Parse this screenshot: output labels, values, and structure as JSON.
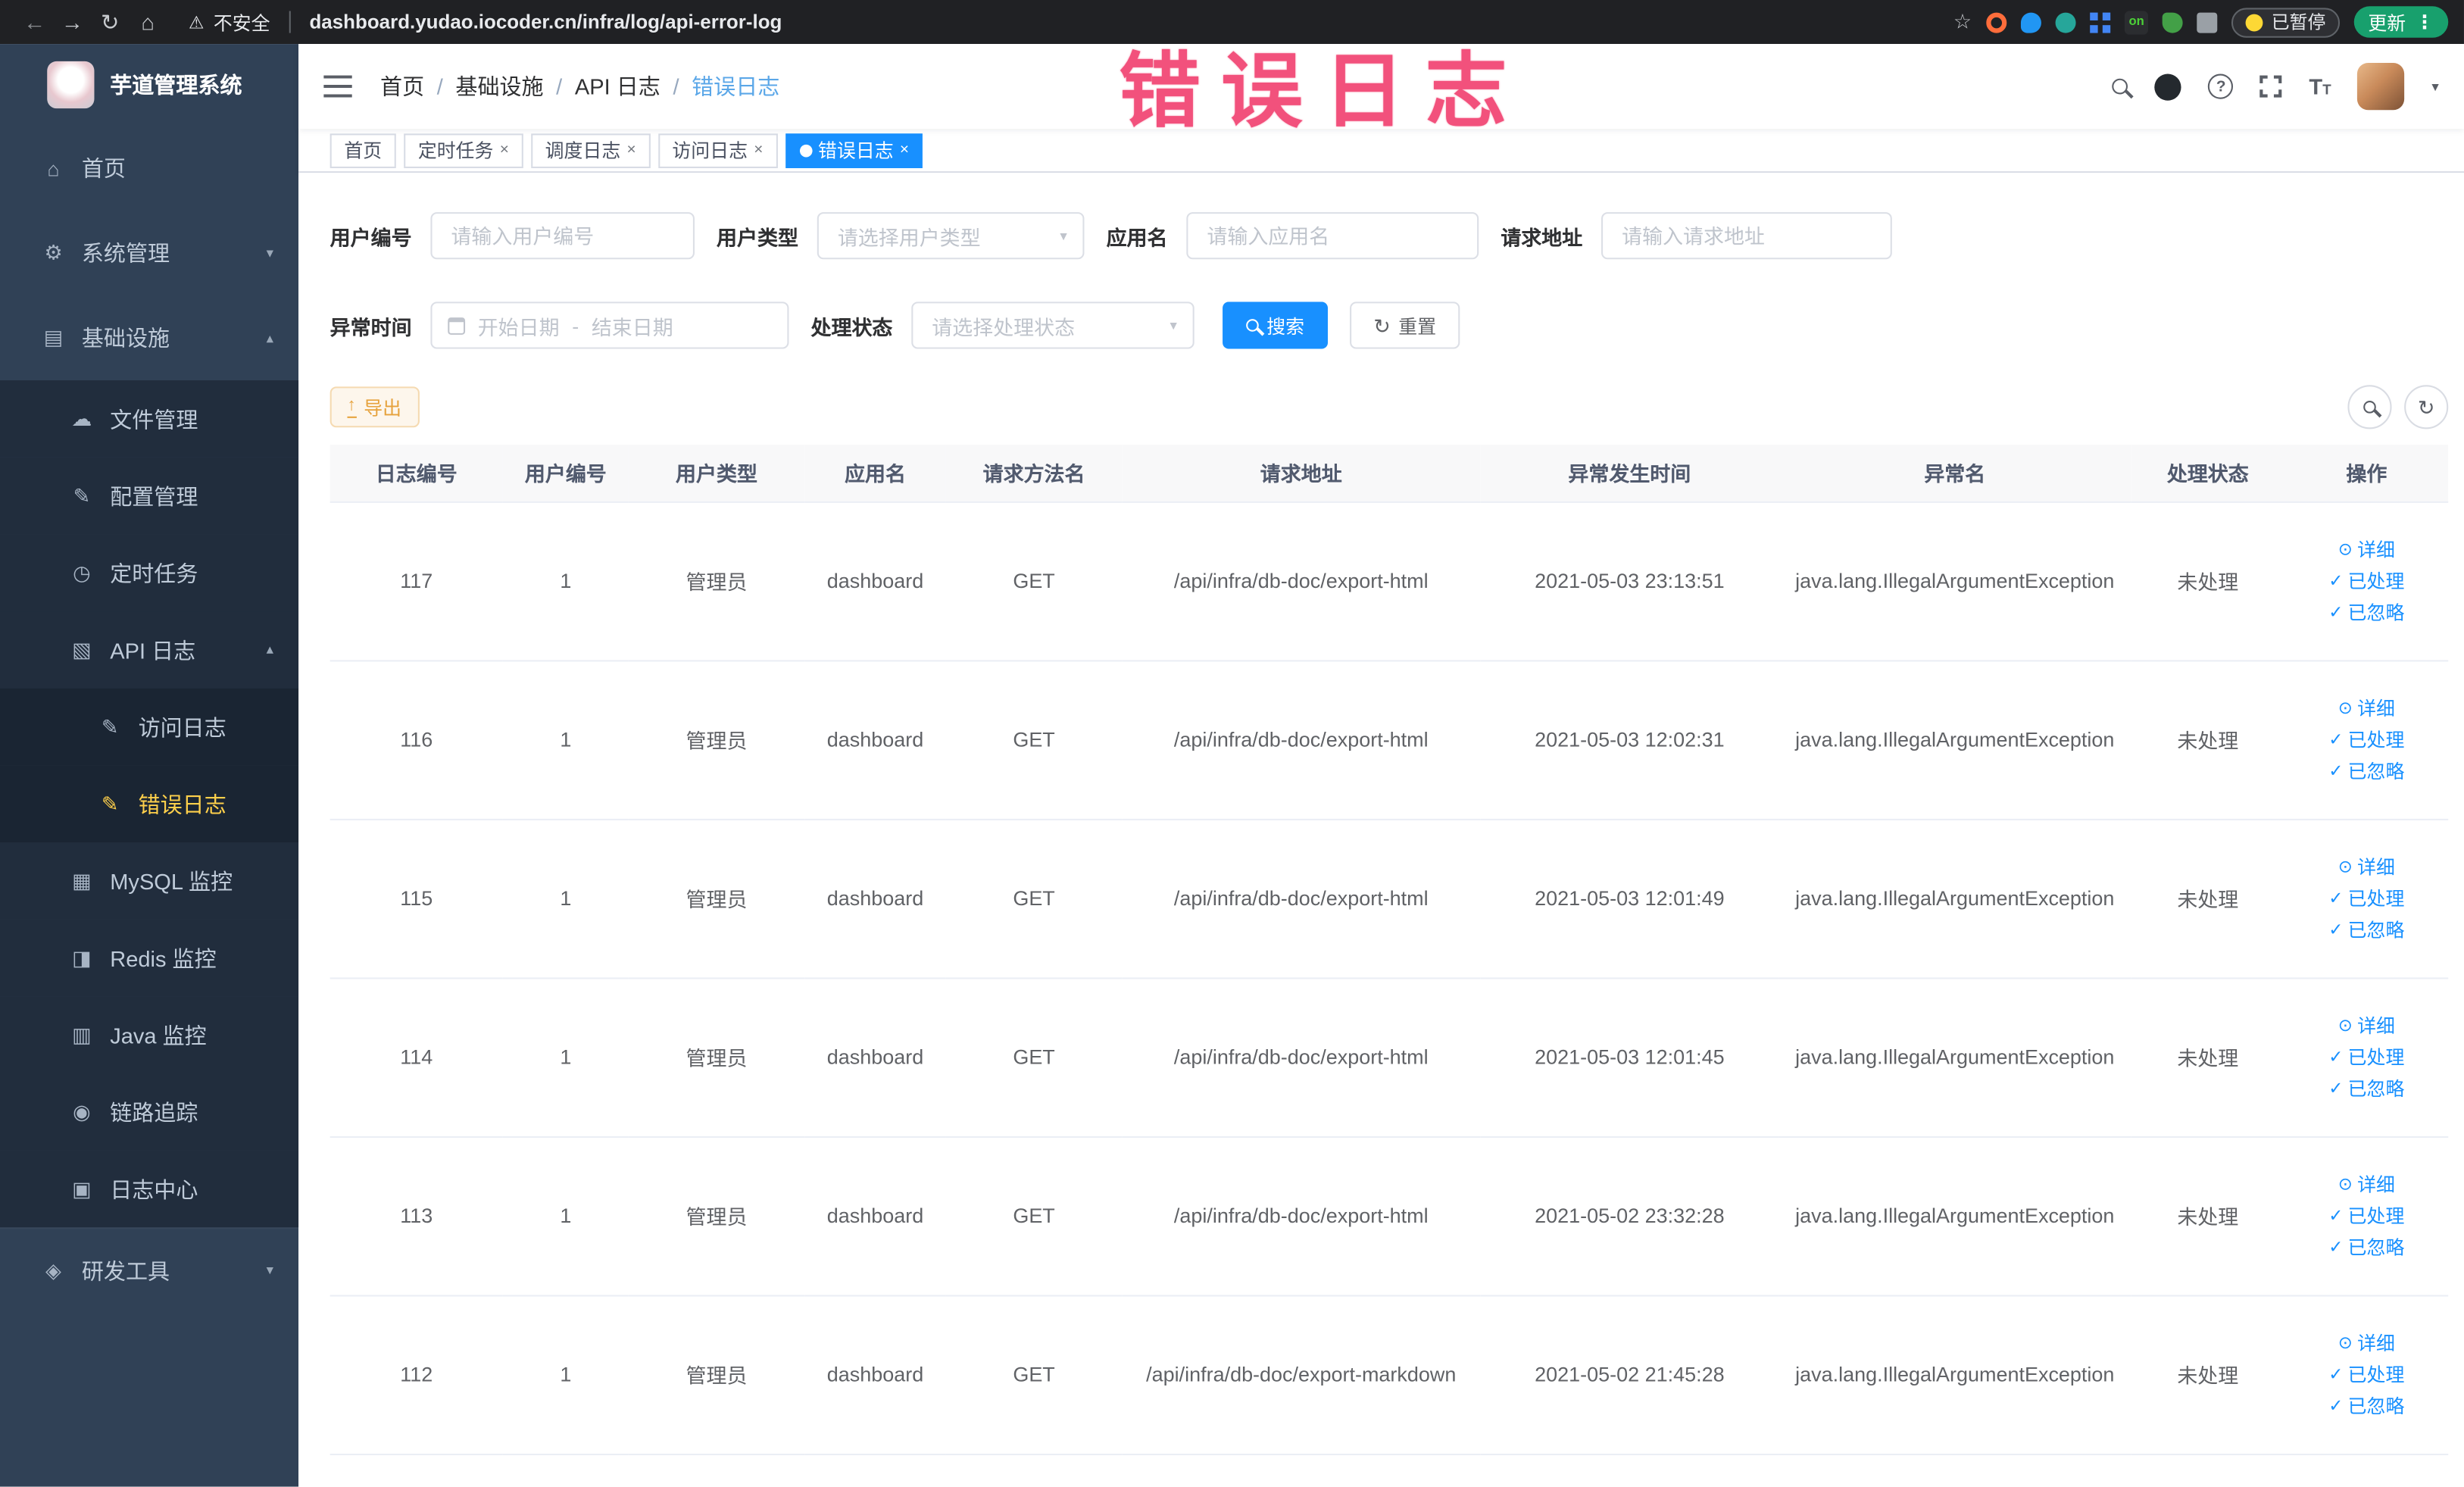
{
  "browser": {
    "security_label": "不安全",
    "url": "dashboard.yudao.iocoder.cn/infra/log/api-error-log",
    "ext_on_label": "on",
    "paused_badge": "已暂停",
    "update_button": "更新"
  },
  "watermark": "错误日志",
  "sidebar": {
    "title": "芋道管理系统",
    "menu": [
      {
        "label": "首页"
      },
      {
        "label": "系统管理"
      },
      {
        "label": "基础设施",
        "children": [
          {
            "label": "文件管理"
          },
          {
            "label": "配置管理"
          },
          {
            "label": "定时任务"
          },
          {
            "label": "API 日志",
            "children": [
              {
                "label": "访问日志"
              },
              {
                "label": "错误日志"
              }
            ]
          },
          {
            "label": "MySQL 监控"
          },
          {
            "label": "Redis 监控"
          },
          {
            "label": "Java 监控"
          },
          {
            "label": "链路追踪"
          },
          {
            "label": "日志中心"
          }
        ]
      },
      {
        "label": "研发工具"
      }
    ]
  },
  "breadcrumb": {
    "items": [
      "首页",
      "基础设施",
      "API 日志",
      "错误日志"
    ]
  },
  "tabs": [
    {
      "label": "首页"
    },
    {
      "label": "定时任务"
    },
    {
      "label": "调度日志"
    },
    {
      "label": "访问日志"
    },
    {
      "label": "错误日志"
    }
  ],
  "filters": {
    "user_id": {
      "label": "用户编号",
      "placeholder": "请输入用户编号"
    },
    "user_type": {
      "label": "用户类型",
      "placeholder": "请选择用户类型"
    },
    "app_name": {
      "label": "应用名",
      "placeholder": "请输入应用名"
    },
    "request_url": {
      "label": "请求地址",
      "placeholder": "请输入请求地址"
    },
    "exception_time": {
      "label": "异常时间",
      "start_placeholder": "开始日期",
      "separator": "-",
      "end_placeholder": "结束日期"
    },
    "process_status": {
      "label": "处理状态",
      "placeholder": "请选择处理状态"
    },
    "search_button": "搜索",
    "reset_button": "重置"
  },
  "toolbar": {
    "export_button": "导出"
  },
  "icons": {
    "detail_icon": "⊙",
    "check_icon": "✓"
  },
  "table": {
    "columns": [
      "日志编号",
      "用户编号",
      "用户类型",
      "应用名",
      "请求方法名",
      "请求地址",
      "异常发生时间",
      "异常名",
      "处理状态",
      "操作"
    ],
    "actions": [
      "详细",
      "已处理",
      "已忽略"
    ],
    "rows": [
      {
        "id": "117",
        "user_id": "1",
        "user_type": "管理员",
        "app": "dashboard",
        "method": "GET",
        "url": "/api/infra/db-doc/export-html",
        "time": "2021-05-03 23:13:51",
        "exception": "java.lang.IllegalArgumentException",
        "status": "未处理"
      },
      {
        "id": "116",
        "user_id": "1",
        "user_type": "管理员",
        "app": "dashboard",
        "method": "GET",
        "url": "/api/infra/db-doc/export-html",
        "time": "2021-05-03 12:02:31",
        "exception": "java.lang.IllegalArgumentException",
        "status": "未处理"
      },
      {
        "id": "115",
        "user_id": "1",
        "user_type": "管理员",
        "app": "dashboard",
        "method": "GET",
        "url": "/api/infra/db-doc/export-html",
        "time": "2021-05-03 12:01:49",
        "exception": "java.lang.IllegalArgumentException",
        "status": "未处理"
      },
      {
        "id": "114",
        "user_id": "1",
        "user_type": "管理员",
        "app": "dashboard",
        "method": "GET",
        "url": "/api/infra/db-doc/export-html",
        "time": "2021-05-03 12:01:45",
        "exception": "java.lang.IllegalArgumentException",
        "status": "未处理"
      },
      {
        "id": "113",
        "user_id": "1",
        "user_type": "管理员",
        "app": "dashboard",
        "method": "GET",
        "url": "/api/infra/db-doc/export-html",
        "time": "2021-05-02 23:32:28",
        "exception": "java.lang.IllegalArgumentException",
        "status": "未处理"
      },
      {
        "id": "112",
        "user_id": "1",
        "user_type": "管理员",
        "app": "dashboard",
        "method": "GET",
        "url": "/api/infra/db-doc/export-markdown",
        "time": "2021-05-02 21:45:28",
        "exception": "java.lang.IllegalArgumentException",
        "status": "未处理"
      }
    ]
  }
}
